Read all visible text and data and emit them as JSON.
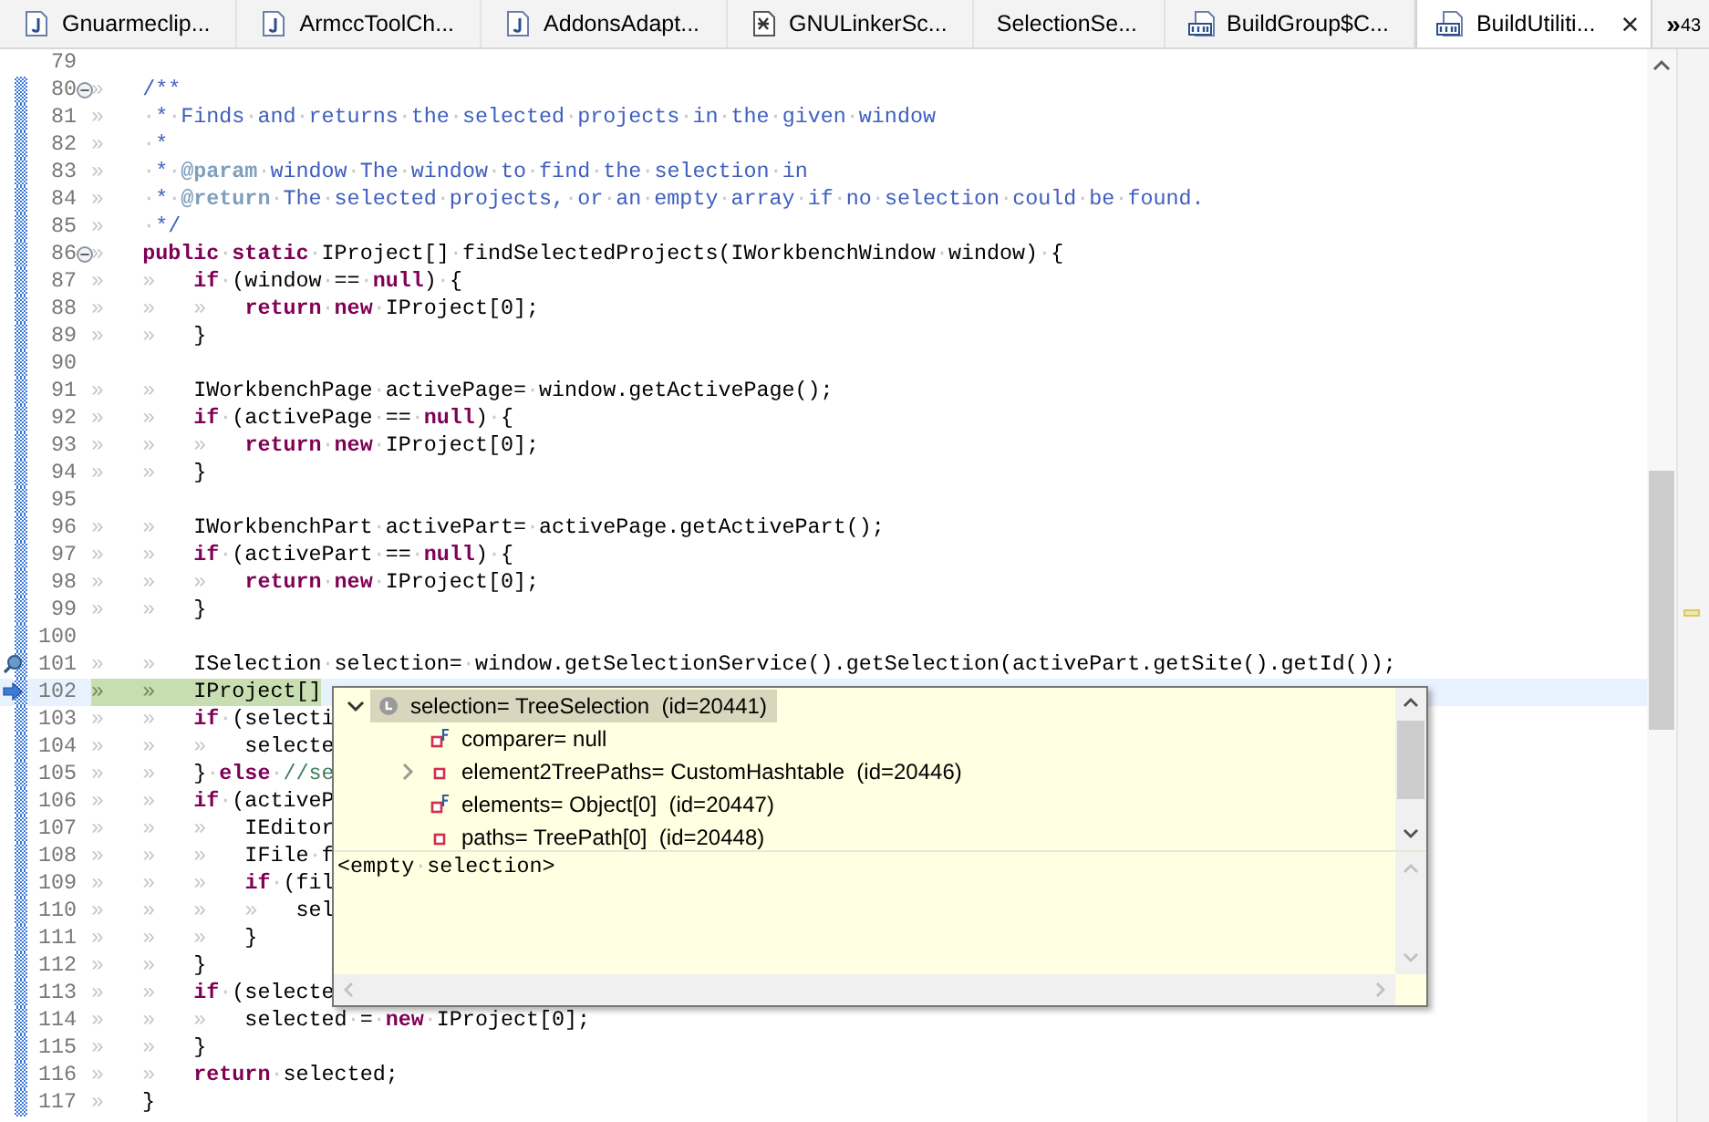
{
  "tabs": [
    {
      "label": "Gnuarmeclip...",
      "kind": "java",
      "selected": false
    },
    {
      "label": "ArmccToolCh...",
      "kind": "java",
      "selected": false
    },
    {
      "label": "AddonsAdapt...",
      "kind": "java",
      "selected": false
    },
    {
      "label": "GNULinkerSc...",
      "kind": "linker",
      "selected": false
    },
    {
      "label": "SelectionSe...",
      "kind": "plain",
      "selected": false
    },
    {
      "label": "BuildGroup$C...",
      "kind": "class",
      "selected": false
    },
    {
      "label": "BuildUtiliti...",
      "kind": "class",
      "selected": true,
      "close": "×"
    }
  ],
  "overflow": {
    "chevron": "»",
    "count": "43"
  },
  "lines": [
    {
      "number": "79",
      "changed": false
    },
    {
      "number": "80",
      "changed": true,
      "fold": true,
      "segments": [
        {
          "kind": "plain",
          "text": "»   "
        },
        {
          "kind": "doc",
          "text": "/**"
        }
      ]
    },
    {
      "number": "81",
      "changed": true,
      "segments": [
        {
          "kind": "plain",
          "text": "»   "
        },
        {
          "kind": "doc",
          "text": "·*·Finds·and·returns·the·selected·projects·in·the·given·window"
        }
      ]
    },
    {
      "number": "82",
      "changed": true,
      "segments": [
        {
          "kind": "plain",
          "text": "»   "
        },
        {
          "kind": "doc",
          "text": "·*"
        }
      ]
    },
    {
      "number": "83",
      "changed": true,
      "segments": [
        {
          "kind": "plain",
          "text": "»   "
        },
        {
          "kind": "doc",
          "text": "·*·"
        },
        {
          "kind": "tag",
          "text": "@param"
        },
        {
          "kind": "doc",
          "text": "·window·The·window·to·find·the·selection·in"
        }
      ]
    },
    {
      "number": "84",
      "changed": true,
      "segments": [
        {
          "kind": "plain",
          "text": "»   "
        },
        {
          "kind": "doc",
          "text": "·*·"
        },
        {
          "kind": "tag",
          "text": "@return"
        },
        {
          "kind": "doc",
          "text": "·The·selected·projects,·or·an·empty·array·if·no·selection·could·be·found."
        }
      ]
    },
    {
      "number": "85",
      "changed": true,
      "segments": [
        {
          "kind": "plain",
          "text": "»   "
        },
        {
          "kind": "doc",
          "text": "·*/"
        }
      ]
    },
    {
      "number": "86",
      "changed": true,
      "fold": true,
      "segments": [
        {
          "kind": "plain",
          "text": "»   "
        },
        {
          "kind": "keyword",
          "text": "public"
        },
        {
          "kind": "plain",
          "text": "·"
        },
        {
          "kind": "keyword",
          "text": "static"
        },
        {
          "kind": "plain",
          "text": "·IProject[]·findSelectedProjects(IWorkbenchWindow·window)·{"
        }
      ]
    },
    {
      "number": "87",
      "changed": true,
      "segments": [
        {
          "kind": "plain",
          "text": "»   »   "
        },
        {
          "kind": "keyword",
          "text": "if"
        },
        {
          "kind": "plain",
          "text": "·(window·==·"
        },
        {
          "kind": "keyword",
          "text": "null"
        },
        {
          "kind": "plain",
          "text": ")·{"
        }
      ]
    },
    {
      "number": "88",
      "changed": true,
      "segments": [
        {
          "kind": "plain",
          "text": "»   »   »   "
        },
        {
          "kind": "keyword",
          "text": "return"
        },
        {
          "kind": "plain",
          "text": "·"
        },
        {
          "kind": "keyword",
          "text": "new"
        },
        {
          "kind": "plain",
          "text": "·IProject[0];"
        }
      ]
    },
    {
      "number": "89",
      "changed": true,
      "segments": [
        {
          "kind": "plain",
          "text": "»   »   }"
        }
      ]
    },
    {
      "number": "90",
      "changed": true
    },
    {
      "number": "91",
      "changed": true,
      "segments": [
        {
          "kind": "plain",
          "text": "»   »   IWorkbenchPage·activePage=·window.getActivePage();"
        }
      ]
    },
    {
      "number": "92",
      "changed": true,
      "segments": [
        {
          "kind": "plain",
          "text": "»   »   "
        },
        {
          "kind": "keyword",
          "text": "if"
        },
        {
          "kind": "plain",
          "text": "·(activePage·==·"
        },
        {
          "kind": "keyword",
          "text": "null"
        },
        {
          "kind": "plain",
          "text": ")·{"
        }
      ]
    },
    {
      "number": "93",
      "changed": true,
      "segments": [
        {
          "kind": "plain",
          "text": "»   »   »   "
        },
        {
          "kind": "keyword",
          "text": "return"
        },
        {
          "kind": "plain",
          "text": "·"
        },
        {
          "kind": "keyword",
          "text": "new"
        },
        {
          "kind": "plain",
          "text": "·IProject[0];"
        }
      ]
    },
    {
      "number": "94",
      "changed": true,
      "segments": [
        {
          "kind": "plain",
          "text": "»   »   }"
        }
      ]
    },
    {
      "number": "95",
      "changed": true
    },
    {
      "number": "96",
      "changed": true,
      "segments": [
        {
          "kind": "plain",
          "text": "»   »   IWorkbenchPart·activePart=·activePage.getActivePart();"
        }
      ]
    },
    {
      "number": "97",
      "changed": true,
      "segments": [
        {
          "kind": "plain",
          "text": "»   »   "
        },
        {
          "kind": "keyword",
          "text": "if"
        },
        {
          "kind": "plain",
          "text": "·(activePart·==·"
        },
        {
          "kind": "keyword",
          "text": "null"
        },
        {
          "kind": "plain",
          "text": ")·{"
        }
      ]
    },
    {
      "number": "98",
      "changed": true,
      "segments": [
        {
          "kind": "plain",
          "text": "»   »   »   "
        },
        {
          "kind": "keyword",
          "text": "return"
        },
        {
          "kind": "plain",
          "text": "·"
        },
        {
          "kind": "keyword",
          "text": "new"
        },
        {
          "kind": "plain",
          "text": "·IProject[0];"
        }
      ]
    },
    {
      "number": "99",
      "changed": true,
      "segments": [
        {
          "kind": "plain",
          "text": "»   »   }"
        }
      ]
    },
    {
      "number": "100",
      "changed": true
    },
    {
      "number": "101",
      "changed": true,
      "kind": "breakpoint",
      "segments": [
        {
          "kind": "plain",
          "text": "»   »   ISelection·selection=·window.getSelectionService().getSelection(activePart.getSite().getId());"
        }
      ]
    },
    {
      "number": "102",
      "changed": true,
      "kind": "pointer",
      "current": true,
      "segments": [
        {
          "kind": "plain",
          "text": "»   »   IProject[]"
        }
      ]
    },
    {
      "number": "103",
      "changed": true,
      "segments": [
        {
          "kind": "plain",
          "text": "»   »   "
        },
        {
          "kind": "keyword",
          "text": "if"
        },
        {
          "kind": "plain",
          "text": "·(selecti"
        }
      ]
    },
    {
      "number": "104",
      "changed": true,
      "segments": [
        {
          "kind": "plain",
          "text": "»   »   »   selecte"
        }
      ]
    },
    {
      "number": "105",
      "changed": true,
      "segments": [
        {
          "kind": "plain",
          "text": "»   »   }·"
        },
        {
          "kind": "keyword",
          "text": "else"
        },
        {
          "kind": "plain",
          "text": "·"
        },
        {
          "kind": "comment",
          "text": "//se"
        }
      ]
    },
    {
      "number": "106",
      "changed": true,
      "segments": [
        {
          "kind": "plain",
          "text": "»   »   "
        },
        {
          "kind": "keyword",
          "text": "if"
        },
        {
          "kind": "plain",
          "text": "·(activeP"
        }
      ]
    },
    {
      "number": "107",
      "changed": true,
      "segments": [
        {
          "kind": "plain",
          "text": "»   »   »   IEditor"
        }
      ]
    },
    {
      "number": "108",
      "changed": true,
      "segments": [
        {
          "kind": "plain",
          "text": "»   »   »   IFile·f"
        }
      ]
    },
    {
      "number": "109",
      "changed": true,
      "segments": [
        {
          "kind": "plain",
          "text": "»   »   »   "
        },
        {
          "kind": "keyword",
          "text": "if"
        },
        {
          "kind": "plain",
          "text": "·(fil"
        }
      ]
    },
    {
      "number": "110",
      "changed": true,
      "segments": [
        {
          "kind": "plain",
          "text": "»   »   »   »   sel"
        }
      ]
    },
    {
      "number": "111",
      "changed": true,
      "segments": [
        {
          "kind": "plain",
          "text": "»   »   »   }"
        }
      ]
    },
    {
      "number": "112",
      "changed": true,
      "segments": [
        {
          "kind": "plain",
          "text": "»   »   }"
        }
      ]
    },
    {
      "number": "113",
      "changed": true,
      "segments": [
        {
          "kind": "plain",
          "text": "»   »   "
        },
        {
          "kind": "keyword",
          "text": "if"
        },
        {
          "kind": "plain",
          "text": "·(selecte"
        }
      ]
    },
    {
      "number": "114",
      "changed": true,
      "segments": [
        {
          "kind": "plain",
          "text": "»   »   »   selected·=·"
        },
        {
          "kind": "keyword",
          "text": "new"
        },
        {
          "kind": "plain",
          "text": "·IProject[0];"
        }
      ]
    },
    {
      "number": "115",
      "changed": true,
      "segments": [
        {
          "kind": "plain",
          "text": "»   »   }"
        }
      ]
    },
    {
      "number": "116",
      "changed": true,
      "segments": [
        {
          "kind": "plain",
          "text": "»   »   "
        },
        {
          "kind": "keyword",
          "text": "return"
        },
        {
          "kind": "plain",
          "text": "·selected;"
        }
      ]
    },
    {
      "number": "117",
      "changed": true,
      "segments": [
        {
          "kind": "plain",
          "text": "»   }"
        }
      ]
    }
  ],
  "hover": {
    "tree": [
      {
        "label": "selection= TreeSelection  (id=20441)",
        "kind": "local",
        "expanded": true,
        "selected": true,
        "children": [
          {
            "label": "comparer= null",
            "kind": "final_field",
            "selected": false
          },
          {
            "label": "element2TreePaths= CustomHashtable  (id=20446)",
            "kind": "field",
            "expanded": false,
            "selected": false
          },
          {
            "label": "elements= Object[0]  (id=20447)",
            "kind": "final_field",
            "selected": false
          },
          {
            "label": "paths= TreePath[0]  (id=20448)",
            "kind": "field",
            "selected": false
          }
        ]
      }
    ],
    "detail": "<empty·selection>"
  }
}
